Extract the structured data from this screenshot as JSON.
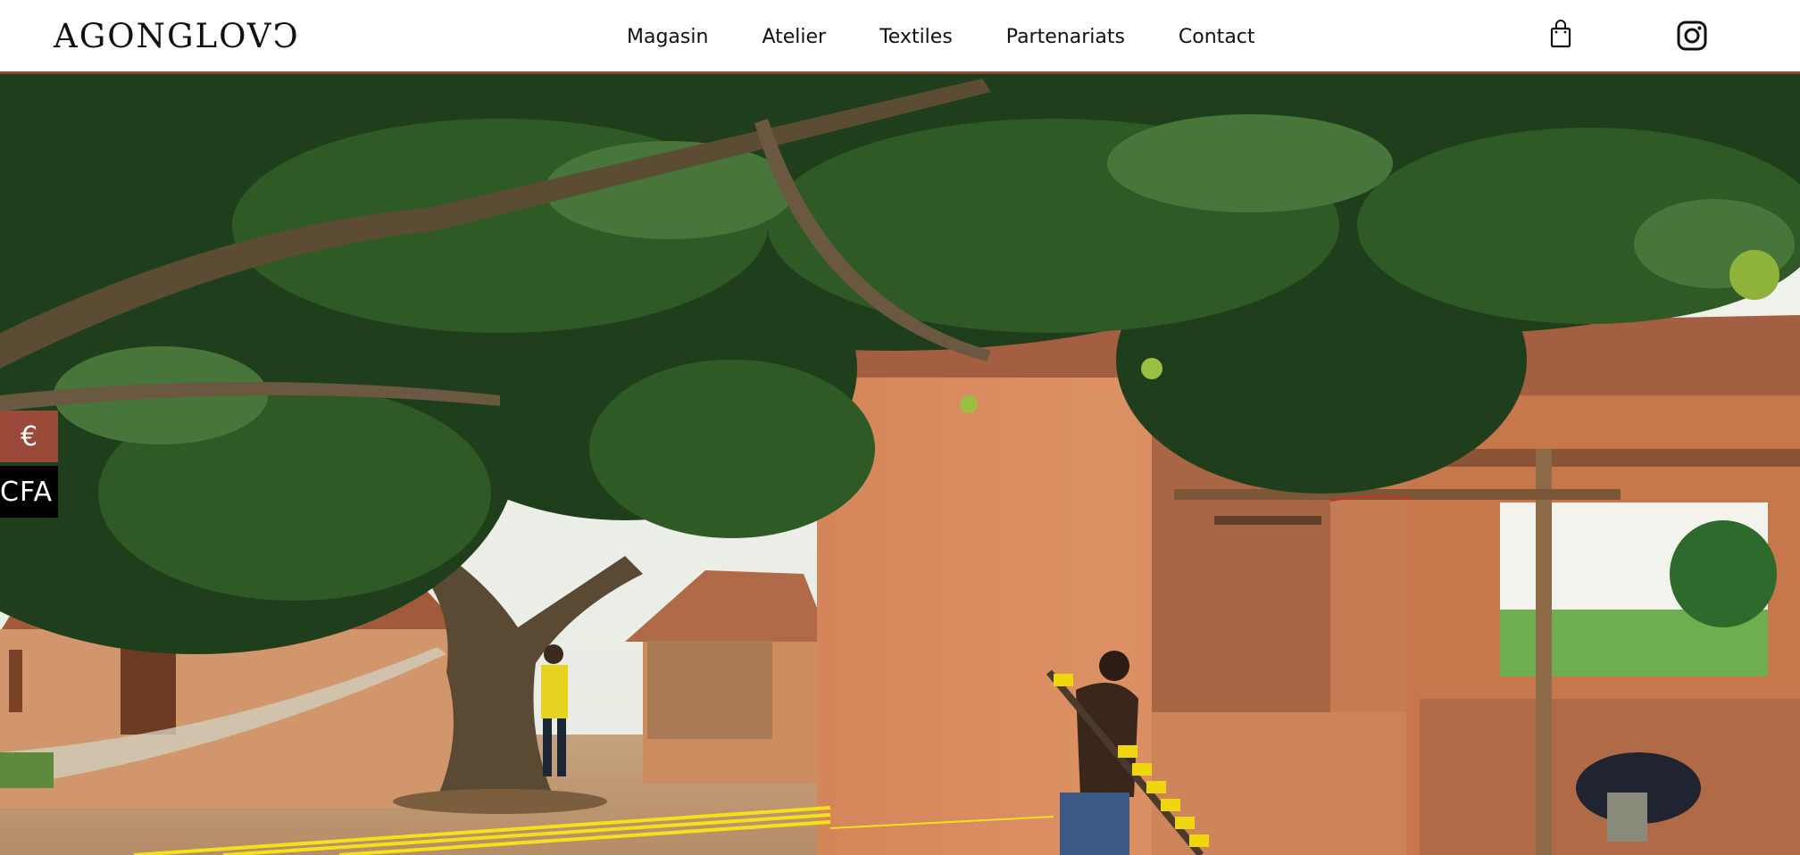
{
  "header": {
    "logo": "AGONGLOVↃ",
    "nav": [
      {
        "label": "Magasin"
      },
      {
        "label": "Atelier"
      },
      {
        "label": "Textiles"
      },
      {
        "label": "Partenariats"
      },
      {
        "label": "Contact"
      }
    ],
    "icons": {
      "cart": "shopping-bag-icon",
      "social": "instagram-icon"
    }
  },
  "currency": {
    "eur_label": "€",
    "cfa_label": "CFA"
  },
  "colors": {
    "accent": "#9b4a39",
    "header_border": "#8a4a35"
  }
}
